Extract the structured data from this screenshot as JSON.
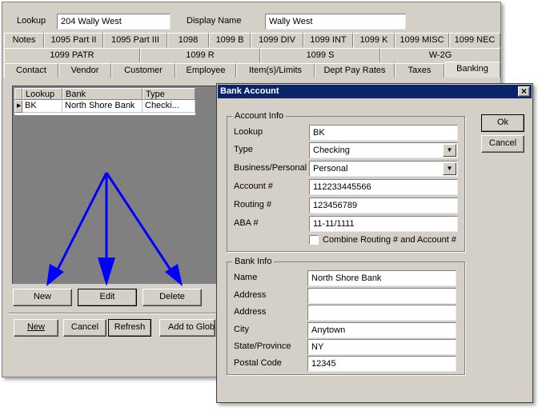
{
  "main": {
    "lookup_label": "Lookup",
    "lookup_value": "204 Wally West",
    "display_name_label": "Display Name",
    "display_name_value": "Wally West",
    "tabs_row1": [
      "Notes",
      "1095 Part II",
      "1095 Part III",
      "1098",
      "1099 B",
      "1099 DIV",
      "1099 INT",
      "1099 K",
      "1099 MISC",
      "1099 NEC"
    ],
    "tabs_row2": [
      "1099 PATR",
      "1099 R",
      "1099 S",
      "W-2G"
    ],
    "tabs_row3": [
      "Contact",
      "Vendor",
      "Customer",
      "Employee",
      "Item(s)/Limits",
      "Dept Pay Rates",
      "Taxes",
      "Banking"
    ],
    "grid": {
      "headers": [
        "Lookup",
        "Bank",
        "Type"
      ],
      "row": [
        "BK",
        "North Shore Bank",
        "Checki..."
      ]
    },
    "grid_buttons": {
      "new": "New",
      "edit": "Edit",
      "delete": "Delete"
    },
    "bottom_buttons": {
      "new": "New",
      "cancel": "Cancel",
      "refresh": "Refresh",
      "add_to_global": "Add to Globa"
    }
  },
  "dialog": {
    "title": "Bank Account",
    "close_glyph": "×",
    "ok_label": "Ok",
    "cancel_label": "Cancel",
    "account_info": {
      "legend": "Account Info",
      "lookup_label": "Lookup",
      "lookup_value": "BK",
      "type_label": "Type",
      "type_value": "Checking",
      "bp_label": "Business/Personal",
      "bp_value": "Personal",
      "account_label": "Account #",
      "account_value": "112233445566",
      "routing_label": "Routing #",
      "routing_value": "123456789",
      "aba_label": "ABA #",
      "aba_value": "11-11/1111",
      "combine_label": "Combine Routing # and Account #",
      "combine_checked": false
    },
    "bank_info": {
      "legend": "Bank Info",
      "name_label": "Name",
      "name_value": "North Shore Bank",
      "address1_label": "Address",
      "address1_value": "",
      "address2_label": "Address",
      "address2_value": "",
      "city_label": "City",
      "city_value": "Anytown",
      "state_label": "State/Province",
      "state_value": "NY",
      "postal_label": "Postal Code",
      "postal_value": "12345"
    }
  },
  "colors": {
    "window_bg": "#d4d0c8",
    "title_bar": "#0a246a",
    "arrow": "#0000ff",
    "grid_area": "#808080"
  }
}
